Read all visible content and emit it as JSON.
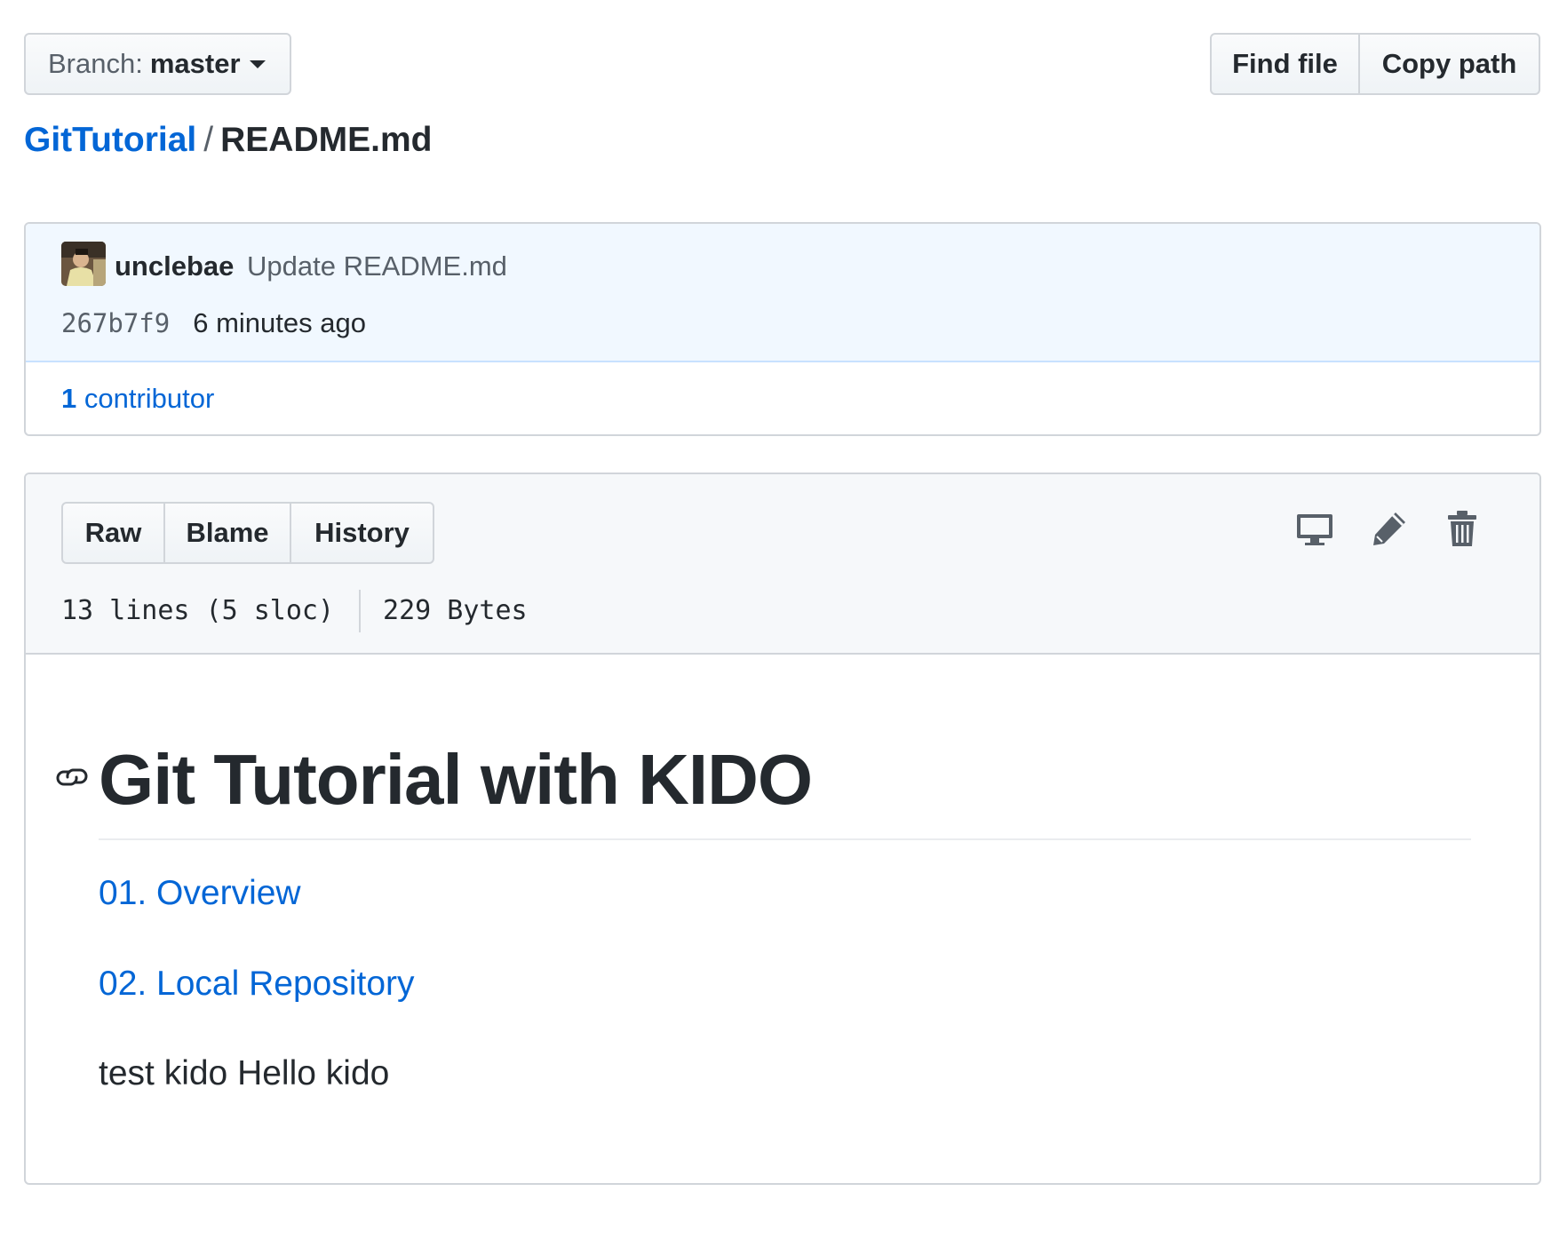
{
  "branch": {
    "label": "Branch:",
    "value": "master"
  },
  "top_actions": {
    "find_file": "Find file",
    "copy_path": "Copy path"
  },
  "breadcrumb": {
    "repo": "GitTutorial",
    "separator": "/",
    "file": "README.md"
  },
  "commit": {
    "author": "unclebae",
    "message": "Update README.md",
    "sha": "267b7f9",
    "time": "6 minutes ago",
    "contributors_count": "1",
    "contributors_label": "contributor"
  },
  "file_actions": {
    "raw": "Raw",
    "blame": "Blame",
    "history": "History"
  },
  "file_icons": [
    "desktop-icon",
    "pencil-icon",
    "trash-icon"
  ],
  "file_info": {
    "lines": "13 lines (5 sloc)",
    "size": "229 Bytes"
  },
  "readme": {
    "heading": "Git Tutorial with KIDO",
    "links": [
      "01. Overview",
      "02. Local Repository"
    ],
    "text": "test kido Hello kido"
  },
  "colors": {
    "link": "#0366d6",
    "text": "#24292e",
    "muted": "#586069",
    "border": "#d1d5da",
    "commit_bg": "#f1f8ff"
  }
}
